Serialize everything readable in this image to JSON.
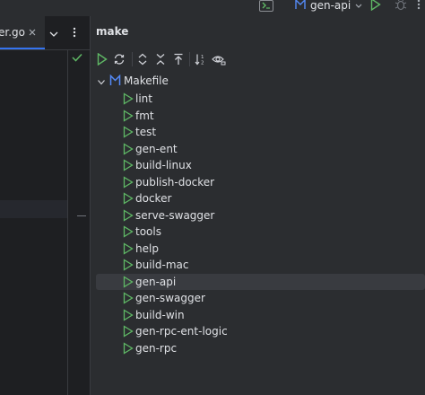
{
  "topbar": {
    "run_config_name": "gen-api"
  },
  "editor": {
    "tab_label": "er.go"
  },
  "make_panel": {
    "title": "make",
    "root": {
      "label": "Makefile"
    },
    "tasks": [
      {
        "label": "lint"
      },
      {
        "label": "fmt"
      },
      {
        "label": "test"
      },
      {
        "label": "gen-ent"
      },
      {
        "label": "build-linux"
      },
      {
        "label": "publish-docker"
      },
      {
        "label": "docker"
      },
      {
        "label": "serve-swagger"
      },
      {
        "label": "tools"
      },
      {
        "label": "help"
      },
      {
        "label": "build-mac"
      },
      {
        "label": "gen-api",
        "selected": true
      },
      {
        "label": "gen-swagger"
      },
      {
        "label": "build-win"
      },
      {
        "label": "gen-rpc-ent-logic"
      },
      {
        "label": "gen-rpc"
      }
    ]
  },
  "colors": {
    "background": "#1e1f22",
    "panel": "#2b2d30",
    "run_green": "#5fb865",
    "selection": "#393b40",
    "text": "#dfe1e5"
  }
}
